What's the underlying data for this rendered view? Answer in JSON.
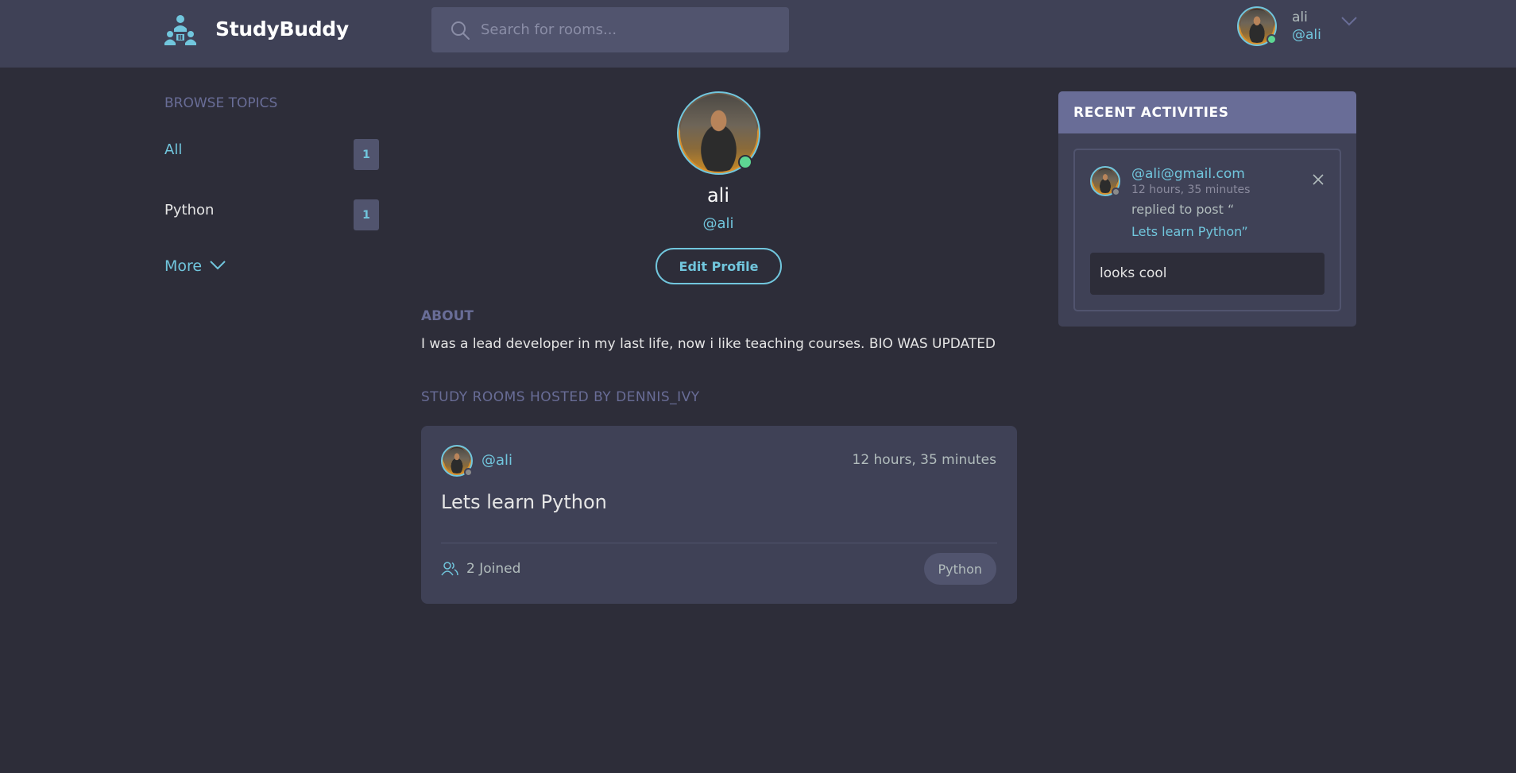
{
  "header": {
    "brand": "StudyBuddy",
    "search_placeholder": "Search for rooms...",
    "user": {
      "name": "ali",
      "handle": "@ali"
    }
  },
  "sidebar": {
    "title": "BROWSE TOPICS",
    "topics": [
      {
        "label": "All",
        "count": "1"
      },
      {
        "label": "Python",
        "count": "1"
      }
    ],
    "more_label": "More"
  },
  "profile": {
    "name": "ali",
    "handle": "@ali",
    "edit_label": "Edit Profile",
    "about_title": "ABOUT",
    "about_text": "I was a lead developer in my last life, now i like teaching courses. BIO WAS UPDATED",
    "hosted_title": "STUDY ROOMS HOSTED BY DENNIS_IVY"
  },
  "rooms": [
    {
      "host": "@ali",
      "time": "12 hours, 35 minutes",
      "title": "Lets learn Python",
      "joined": "2 Joined",
      "topic": "Python"
    }
  ],
  "activities": {
    "title": "RECENT ACTIVITIES",
    "items": [
      {
        "user": "@ali@gmail.com",
        "time": "12 hours, 35 minutes",
        "text": "replied to post “",
        "link": "Lets learn Python”",
        "message": "looks cool"
      }
    ]
  },
  "colors": {
    "background": "#2d2d39",
    "panel": "#3f4156",
    "accent": "#71c6dd",
    "muted": "#696d97",
    "online": "#5dd693"
  },
  "icons": [
    "logo-icon",
    "search-icon",
    "chevron-down-icon",
    "users-icon",
    "close-icon"
  ]
}
